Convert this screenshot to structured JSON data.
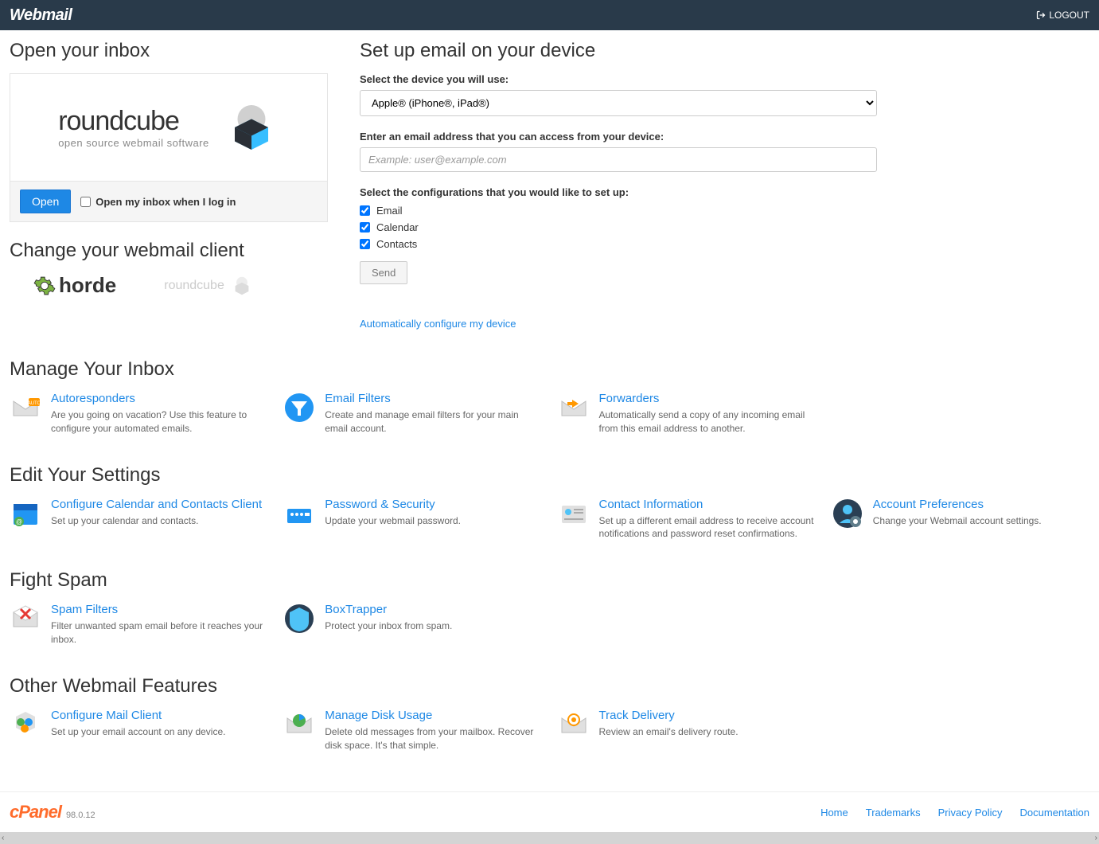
{
  "header": {
    "brand": "Webmail",
    "logout": "LOGOUT"
  },
  "inbox": {
    "heading": "Open your inbox",
    "client_name": "roundcube",
    "client_tagline": "open source webmail software",
    "open_btn": "Open",
    "auto_open_label": "Open my inbox when I log in"
  },
  "change_client": {
    "heading": "Change your webmail client",
    "horde": "horde",
    "roundcube": "roundcube"
  },
  "setup": {
    "heading": "Set up email on your device",
    "device_label": "Select the device you will use:",
    "device_value": "Apple® (iPhone®, iPad®)",
    "email_label": "Enter an email address that you can access from your device:",
    "email_placeholder": "Example: user@example.com",
    "config_label": "Select the configurations that you would like to set up:",
    "checks": {
      "email": "Email",
      "calendar": "Calendar",
      "contacts": "Contacts"
    },
    "send_btn": "Send",
    "auto_link": "Automatically configure my device"
  },
  "sections": [
    {
      "heading": "Manage Your Inbox",
      "items": [
        {
          "title": "Autoresponders",
          "desc": "Are you going on vacation? Use this feature to configure your automated emails."
        },
        {
          "title": "Email Filters",
          "desc": "Create and manage email filters for your main email account."
        },
        {
          "title": "Forwarders",
          "desc": "Automatically send a copy of any incoming email from this email address to another."
        }
      ]
    },
    {
      "heading": "Edit Your Settings",
      "items": [
        {
          "title": "Configure Calendar and Contacts Client",
          "desc": "Set up your calendar and contacts."
        },
        {
          "title": "Password & Security",
          "desc": "Update your webmail password."
        },
        {
          "title": "Contact Information",
          "desc": "Set up a different email address to receive account notifications and password reset confirmations."
        },
        {
          "title": "Account Preferences",
          "desc": "Change your Webmail account settings."
        }
      ]
    },
    {
      "heading": "Fight Spam",
      "items": [
        {
          "title": "Spam Filters",
          "desc": "Filter unwanted spam email before it reaches your inbox."
        },
        {
          "title": "BoxTrapper",
          "desc": "Protect your inbox from spam."
        }
      ]
    },
    {
      "heading": "Other Webmail Features",
      "items": [
        {
          "title": "Configure Mail Client",
          "desc": "Set up your email account on any device."
        },
        {
          "title": "Manage Disk Usage",
          "desc": "Delete old messages from your mailbox. Recover disk space. It's that simple."
        },
        {
          "title": "Track Delivery",
          "desc": "Review an email's delivery route."
        }
      ]
    }
  ],
  "footer": {
    "brand": "cPanel",
    "version": "98.0.12",
    "links": [
      "Home",
      "Trademarks",
      "Privacy Policy",
      "Documentation"
    ]
  }
}
